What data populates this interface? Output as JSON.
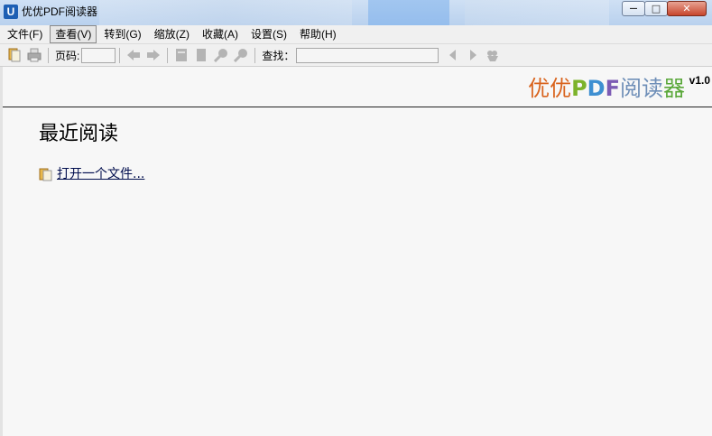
{
  "window": {
    "title": "优优PDF阅读器",
    "app_icon_letter": "U",
    "minimize_symbol": "—",
    "maximize_symbol": "□",
    "close_symbol": "✕"
  },
  "menu": {
    "items": [
      "文件(F)",
      "查看(V)",
      "转到(G)",
      "缩放(Z)",
      "收藏(A)",
      "设置(S)",
      "帮助(H)"
    ],
    "active_index": 1
  },
  "toolbar": {
    "page_label": "页码:",
    "page_value": "",
    "search_label": "查找：",
    "search_value": "",
    "icons": [
      "open-file-icon",
      "print-icon",
      "prev-page-icon",
      "next-page-icon",
      "single-page-icon",
      "fit-page-icon",
      "zoom-in-icon",
      "zoom-out-icon",
      "find-prev-icon",
      "find-next-icon",
      "find-options-icon"
    ]
  },
  "brand": {
    "part1": "优优",
    "part1_color": "#d9631d",
    "part2_p": "P",
    "part2_p_color": "#7cb32b",
    "part2_d": "D",
    "part2_d_color": "#3e8fd1",
    "part2_f": "F",
    "part2_f_color": "#7c5bb4",
    "part3": "阅读",
    "part3_color": "#6f8fb8",
    "part4": "器",
    "part4_color": "#5aa83a",
    "version": "v1.0"
  },
  "main": {
    "recent_title": "最近阅读",
    "open_file_link": "打开一个文件..."
  }
}
